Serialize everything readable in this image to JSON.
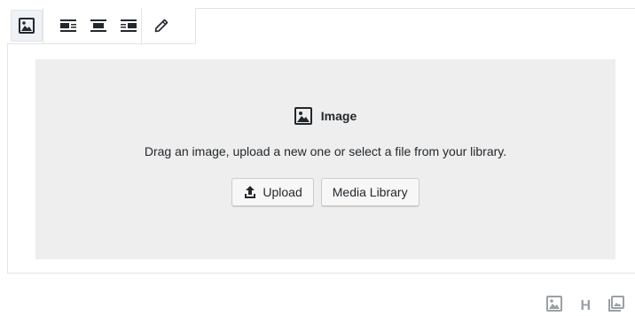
{
  "toolbar": {
    "image_icon": "image-icon",
    "align_left_icon": "align-left-icon",
    "align_center_icon": "align-center-icon",
    "align_right_icon": "align-right-icon",
    "edit_icon": "pencil-icon"
  },
  "placeholder": {
    "label": "Image",
    "instructions": "Drag an image, upload a new one or select a file from your library.",
    "upload_label": "Upload",
    "media_library_label": "Media Library"
  },
  "inserter": {
    "heading_label": "H",
    "image_icon": "image-icon",
    "gallery_icon": "gallery-icon"
  },
  "colors": {
    "placeholder_bg": "#eeeeee",
    "border": "#e2e4e7",
    "icon_muted": "#9aa0a6"
  }
}
